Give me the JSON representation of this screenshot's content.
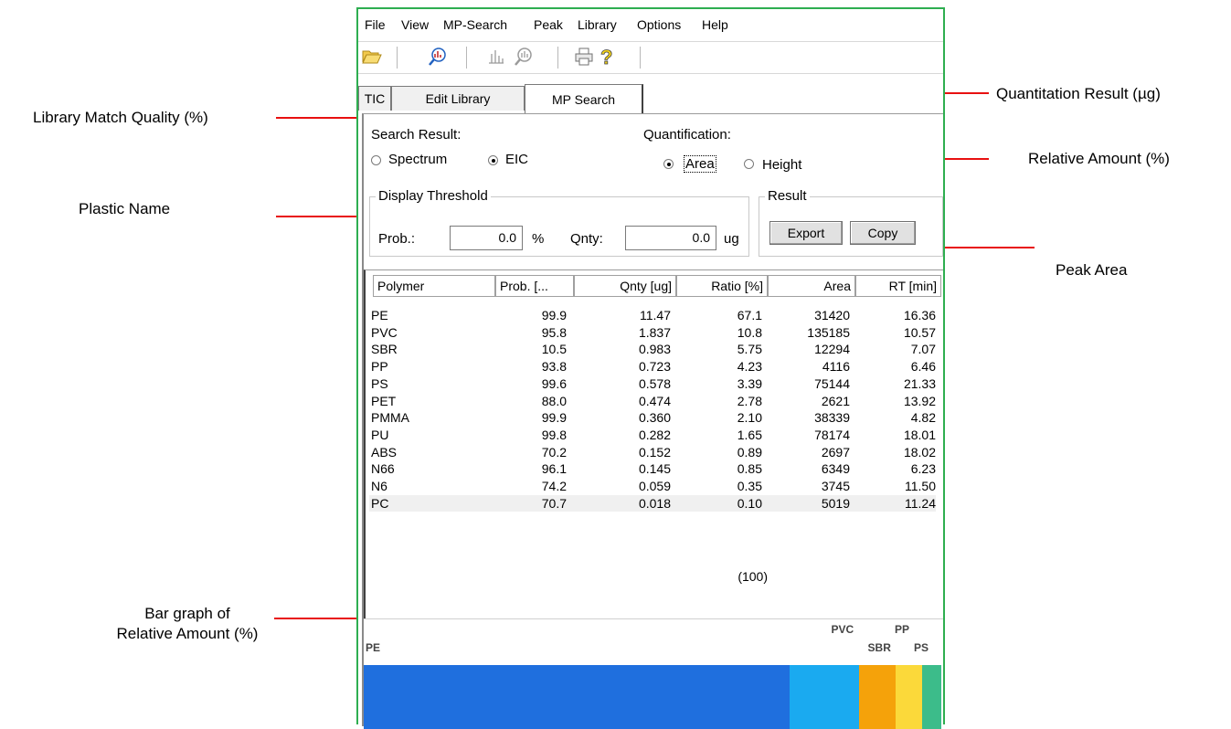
{
  "callouts": {
    "library_match_quality": "Library Match Quality (%)",
    "plastic_name": "Plastic Name",
    "quantitation_result": "Quantitation Result (µg)",
    "relative_amount": "Relative Amount (%)",
    "peak_area": "Peak Area",
    "bar_graph_line1": "Bar graph of",
    "bar_graph_line2": "Relative Amount (%)"
  },
  "menu": [
    "File",
    "View",
    "MP-Search",
    "Peak",
    "Library",
    "Options",
    "Help"
  ],
  "toolbar": {
    "icons": [
      "open-folder-icon",
      "search-spectrum-icon",
      "peak-icon",
      "zoom-search-icon",
      "print-icon",
      "help-icon"
    ]
  },
  "tabs": [
    "TIC",
    "Edit Library",
    "MP Search"
  ],
  "search_result": {
    "label": "Search Result:",
    "options": [
      "Spectrum",
      "EIC"
    ],
    "selected": "EIC"
  },
  "quantification": {
    "label": "Quantification:",
    "options": [
      "Area",
      "Height"
    ],
    "selected": "Area"
  },
  "threshold": {
    "title": "Display Threshold",
    "prob_label": "Prob.:",
    "prob_value": "0.0",
    "prob_unit": "%",
    "qnty_label": "Qnty:",
    "qnty_value": "0.0",
    "qnty_unit": "ug"
  },
  "result": {
    "title": "Result",
    "export_label": "Export",
    "copy_label": "Copy"
  },
  "table": {
    "columns": [
      "Polymer",
      "Prob. [...",
      "Qnty [ug]",
      "Ratio [%]",
      "Area",
      "RT [min]"
    ],
    "rows": [
      {
        "polymer": "PE",
        "prob": "99.9",
        "qnty": "11.47",
        "ratio": "67.1",
        "area": "31420",
        "rt": "16.36"
      },
      {
        "polymer": "PVC",
        "prob": "95.8",
        "qnty": "1.837",
        "ratio": "10.8",
        "area": "135185",
        "rt": "10.57"
      },
      {
        "polymer": "SBR",
        "prob": "10.5",
        "qnty": "0.983",
        "ratio": "5.75",
        "area": "12294",
        "rt": "7.07"
      },
      {
        "polymer": "PP",
        "prob": "93.8",
        "qnty": "0.723",
        "ratio": "4.23",
        "area": "4116",
        "rt": "6.46"
      },
      {
        "polymer": "PS",
        "prob": "99.6",
        "qnty": "0.578",
        "ratio": "3.39",
        "area": "75144",
        "rt": "21.33"
      },
      {
        "polymer": "PET",
        "prob": "88.0",
        "qnty": "0.474",
        "ratio": "2.78",
        "area": "2621",
        "rt": "13.92"
      },
      {
        "polymer": "PMMA",
        "prob": "99.9",
        "qnty": "0.360",
        "ratio": "2.10",
        "area": "38339",
        "rt": "4.82"
      },
      {
        "polymer": "PU",
        "prob": "99.8",
        "qnty": "0.282",
        "ratio": "1.65",
        "area": "78174",
        "rt": "18.01"
      },
      {
        "polymer": "ABS",
        "prob": "70.2",
        "qnty": "0.152",
        "ratio": "0.89",
        "area": "2697",
        "rt": "18.02"
      },
      {
        "polymer": "N66",
        "prob": "96.1",
        "qnty": "0.145",
        "ratio": "0.85",
        "area": "6349",
        "rt": "6.23"
      },
      {
        "polymer": "N6",
        "prob": "74.2",
        "qnty": "0.059",
        "ratio": "0.35",
        "area": "3745",
        "rt": "11.50"
      },
      {
        "polymer": "PC",
        "prob": "70.7",
        "qnty": "0.018",
        "ratio": "0.10",
        "area": "5019",
        "rt": "11.24"
      }
    ],
    "total_ratio": "(100)"
  },
  "bar_graph": {
    "segments": [
      {
        "label": "PE",
        "value": 67.1,
        "color": "#1f6fde"
      },
      {
        "label": "PVC",
        "value": 10.8,
        "color": "#1aaaf0"
      },
      {
        "label": "SBR",
        "value": 5.75,
        "color": "#f5a20a"
      },
      {
        "label": "PP",
        "value": 4.23,
        "color": "#fbd93a"
      },
      {
        "label": "PS",
        "value": 3.39,
        "color": "#3cbc8a"
      }
    ]
  },
  "colors": {
    "callout_line": "#e81010",
    "window_border": "#2eae50"
  }
}
